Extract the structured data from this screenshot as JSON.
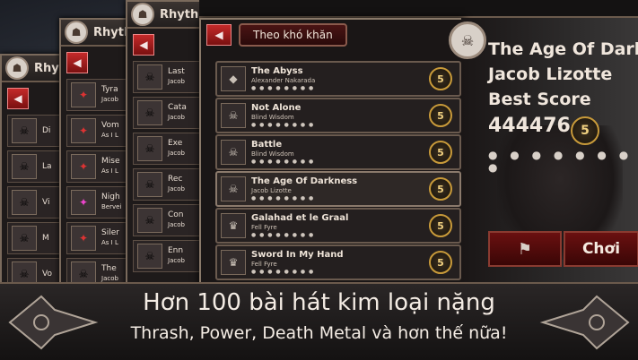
{
  "app": {
    "name": "RhythmGame",
    "name_short": "Rhyth"
  },
  "background_panels": [
    {
      "title": "Rhyth",
      "rows": [
        {
          "t": "Di"
        },
        {
          "t": "La"
        },
        {
          "t": "Vi"
        },
        {
          "t": "M"
        },
        {
          "t": "Vo"
        }
      ]
    },
    {
      "title": "Rhyth",
      "rows": [
        {
          "t": "Tyra",
          "s": "Jacob"
        },
        {
          "t": "Vom",
          "s": "As I L"
        },
        {
          "t": "Mise",
          "s": "As I L"
        },
        {
          "t": "Nigh",
          "s": "Bervei"
        },
        {
          "t": "Siler",
          "s": "As I L"
        },
        {
          "t": "The",
          "s": "Jacob"
        }
      ]
    },
    {
      "title": "Rhyth",
      "rows": [
        {
          "t": "Last",
          "s": "Jacob"
        },
        {
          "t": "Cata",
          "s": "Jacob"
        },
        {
          "t": "Exe",
          "s": "Jacob"
        },
        {
          "t": "Rec",
          "s": "Jacob"
        },
        {
          "t": "Con",
          "s": "Jacob"
        },
        {
          "t": "Enn",
          "s": "Jacob"
        }
      ]
    }
  ],
  "main": {
    "back_label": "◀",
    "filter_tab": "Theo khó khăn",
    "songs": [
      {
        "title": "The Abyss",
        "artist": "Alexander Nakarada",
        "difficulty": "5"
      },
      {
        "title": "Not Alone",
        "artist": "Blind Wisdom",
        "difficulty": "5"
      },
      {
        "title": "Battle",
        "artist": "Blind Wisdom",
        "difficulty": "5"
      },
      {
        "title": "The Age Of Darkness",
        "artist": "Jacob Lizotte",
        "difficulty": "5"
      },
      {
        "title": "Galahad et le Graal",
        "artist": "Fell Fyre",
        "difficulty": "5"
      },
      {
        "title": "Sword In My Hand",
        "artist": "Fell Fyre",
        "difficulty": "5"
      }
    ],
    "dots": "● ● ● ● ● ● ● ●"
  },
  "detail": {
    "song_title": "The Age Of Dark",
    "artist": "Jacob Lizotte",
    "best_score_label": "Best Score",
    "best_score": "444476",
    "difficulty": "5",
    "stars": "● ● ● ● ● ● ● ●",
    "play_label": "Chơi"
  },
  "banner": {
    "line1": "Hơn 100 bài hát kim loại nặng",
    "line2": "Thrash, Power, Death Metal và hơn thế nữa!"
  }
}
